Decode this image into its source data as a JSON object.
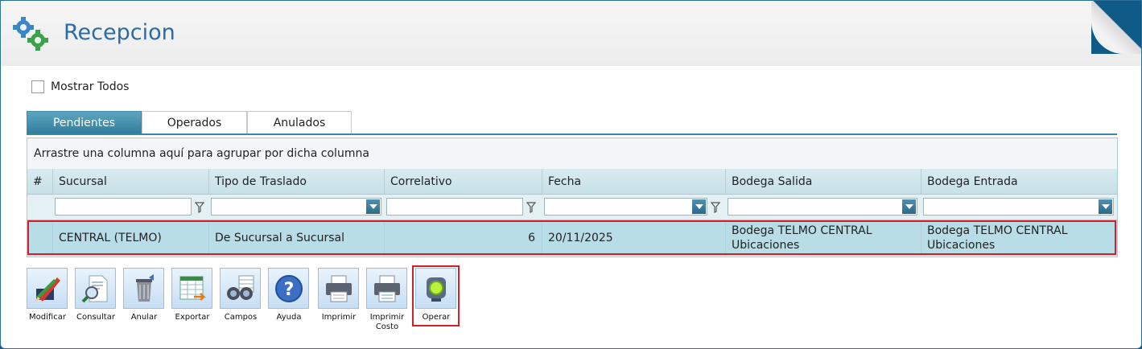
{
  "header": {
    "title": "Recepcion"
  },
  "options": {
    "show_all_label": "Mostrar Todos"
  },
  "tabs": [
    {
      "label": "Pendientes",
      "active": true
    },
    {
      "label": "Operados",
      "active": false
    },
    {
      "label": "Anulados",
      "active": false
    }
  ],
  "grid": {
    "group_panel_text": "Arrastre una columna aquí para agrupar por dicha columna",
    "columns": [
      "#",
      "Sucursal",
      "Tipo de Traslado",
      "Correlativo",
      "Fecha",
      "Bodega Salida",
      "Bodega Entrada"
    ],
    "rows": [
      {
        "sucursal": "CENTRAL (TELMO)",
        "tipo_traslado": "De Sucursal a Sucursal",
        "correlativo": "6",
        "fecha": "20/11/2025",
        "bodega_salida_1": "Bodega TELMO CENTRAL",
        "bodega_salida_2": "Ubicaciones",
        "bodega_entrada_1": "Bodega TELMO CENTRAL",
        "bodega_entrada_2": "Ubicaciones"
      }
    ]
  },
  "toolbar": {
    "buttons": [
      {
        "label": "Modificar",
        "icon": "edit-pencils-icon"
      },
      {
        "label": "Consultar",
        "icon": "magnifier-document-icon"
      },
      {
        "label": "Anular",
        "icon": "trash-can-icon"
      },
      {
        "label": "Exportar",
        "icon": "spreadsheet-export-icon"
      },
      {
        "label": "Campos",
        "icon": "binoculars-icon"
      },
      {
        "label": "Ayuda",
        "icon": "help-icon"
      },
      {
        "label": "Imprimir",
        "icon": "printer-icon"
      },
      {
        "label_1": "Imprimir",
        "label_2": "Costo",
        "icon": "printer-cost-icon"
      },
      {
        "label": "Operar",
        "icon": "traffic-light-icon"
      }
    ]
  },
  "colors": {
    "accent": "#2b6ba6",
    "highlight": "#d0202a",
    "selected_row": "#b8dde6"
  }
}
